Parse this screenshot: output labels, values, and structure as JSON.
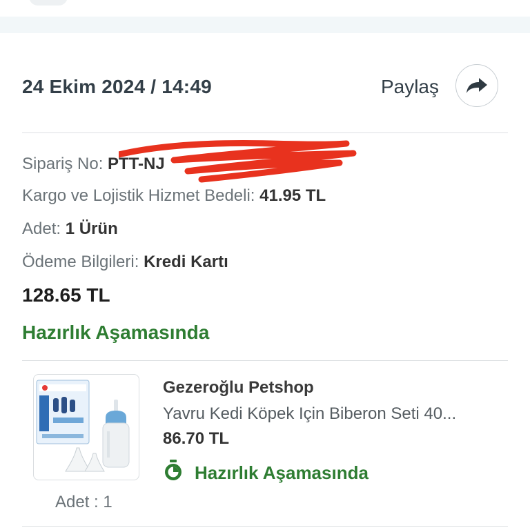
{
  "order": {
    "date_time": "24 Ekim 2024 / 14:49",
    "share_label": "Paylaş",
    "order_no_label": "Sipariş No:",
    "order_no_value": "PTT-NJ",
    "shipping_label": "Kargo ve Lojistik Hizmet Bedeli:",
    "shipping_value": "41.95 TL",
    "quantity_label": "Adet:",
    "quantity_value": "1 Ürün",
    "payment_label": "Ödeme Bilgileri:",
    "payment_value": "Kredi Kartı",
    "total": "128.65 TL",
    "status": "Hazırlık Aşamasında"
  },
  "product": {
    "shop": "Gezeroğlu Petshop",
    "name": "Yavru Kedi Köpek Için Biberon Seti 40...",
    "price": "86.70 TL",
    "status": "Hazırlık Aşamasında",
    "quantity": "Adet : 1"
  },
  "colors": {
    "status_green": "#2e7d32",
    "redaction_red": "#e8321e"
  },
  "icons": {
    "share": "share-arrow-icon",
    "status": "stopwatch-icon"
  }
}
